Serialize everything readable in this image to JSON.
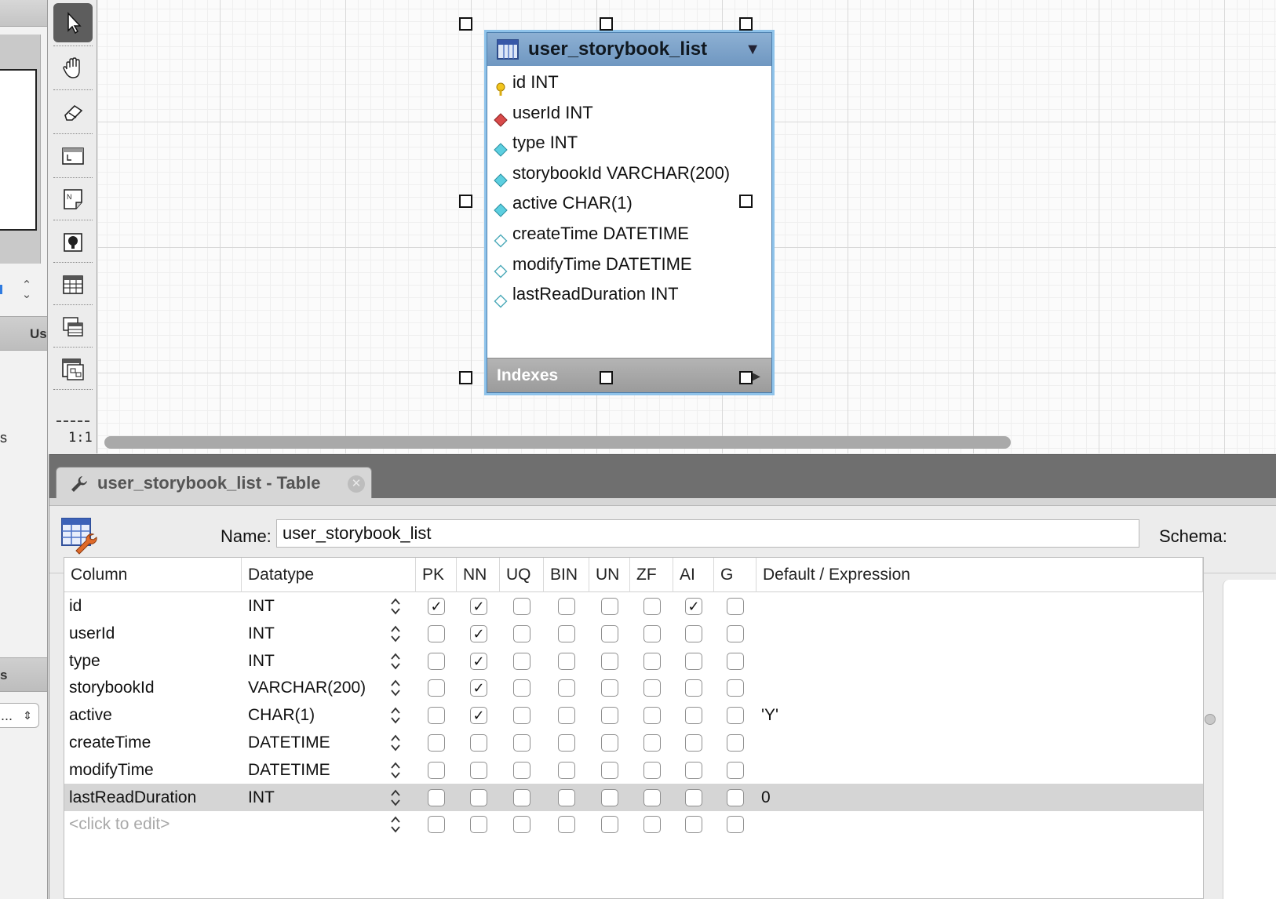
{
  "left_panel": {
    "section1_text": "Us",
    "side_text": "s",
    "section2_text": "s",
    "select_value": "..."
  },
  "toolbar": {
    "zoom_label": "1:1",
    "tools": [
      "pointer-icon",
      "hand-icon",
      "eraser-icon",
      "layer-icon",
      "note-icon",
      "image-icon",
      "table-icon",
      "view-icon",
      "routine-group-icon"
    ]
  },
  "entity": {
    "title": "user_storybook_list",
    "columns": [
      {
        "label": "id INT",
        "icon": "primary-key-icon"
      },
      {
        "label": "userId INT",
        "icon": "foreign-key-icon"
      },
      {
        "label": "type INT",
        "icon": "not-null-column-icon"
      },
      {
        "label": "storybookId VARCHAR(200)",
        "icon": "not-null-column-icon"
      },
      {
        "label": "active CHAR(1)",
        "icon": "not-null-column-icon"
      },
      {
        "label": "createTime DATETIME",
        "icon": "nullable-column-icon"
      },
      {
        "label": "modifyTime DATETIME",
        "icon": "nullable-column-icon"
      },
      {
        "label": "lastReadDuration INT",
        "icon": "nullable-column-icon"
      }
    ],
    "indexes_label": "Indexes"
  },
  "editor": {
    "tab_label": "user_storybook_list - Table",
    "name_label": "Name:",
    "name_value": "user_storybook_list",
    "schema_label": "Schema:",
    "headers": [
      "Column",
      "Datatype",
      "PK",
      "NN",
      "UQ",
      "BIN",
      "UN",
      "ZF",
      "AI",
      "G",
      "Default / Expression"
    ],
    "rows": [
      {
        "column": "id",
        "datatype": "INT",
        "pk": true,
        "nn": true,
        "uq": false,
        "bin": false,
        "un": false,
        "zf": false,
        "ai": true,
        "g": false,
        "default": ""
      },
      {
        "column": "userId",
        "datatype": "INT",
        "pk": false,
        "nn": true,
        "uq": false,
        "bin": false,
        "un": false,
        "zf": false,
        "ai": false,
        "g": false,
        "default": ""
      },
      {
        "column": "type",
        "datatype": "INT",
        "pk": false,
        "nn": true,
        "uq": false,
        "bin": false,
        "un": false,
        "zf": false,
        "ai": false,
        "g": false,
        "default": ""
      },
      {
        "column": "storybookId",
        "datatype": "VARCHAR(200)",
        "pk": false,
        "nn": true,
        "uq": false,
        "bin": false,
        "un": false,
        "zf": false,
        "ai": false,
        "g": false,
        "default": ""
      },
      {
        "column": "active",
        "datatype": "CHAR(1)",
        "pk": false,
        "nn": true,
        "uq": false,
        "bin": false,
        "un": false,
        "zf": false,
        "ai": false,
        "g": false,
        "default": "'Y'"
      },
      {
        "column": "createTime",
        "datatype": "DATETIME",
        "pk": false,
        "nn": false,
        "uq": false,
        "bin": false,
        "un": false,
        "zf": false,
        "ai": false,
        "g": false,
        "default": ""
      },
      {
        "column": "modifyTime",
        "datatype": "DATETIME",
        "pk": false,
        "nn": false,
        "uq": false,
        "bin": false,
        "un": false,
        "zf": false,
        "ai": false,
        "g": false,
        "default": ""
      },
      {
        "column": "lastReadDuration",
        "datatype": "INT",
        "pk": false,
        "nn": false,
        "uq": false,
        "bin": false,
        "un": false,
        "zf": false,
        "ai": false,
        "g": false,
        "default": "0",
        "selected": true
      }
    ],
    "new_row_placeholder": "<click to edit>"
  },
  "colors": {
    "entity_header": "#7aa1c9",
    "selection_outline": "#8fc3ea",
    "selected_row": "#d5d5d5"
  }
}
